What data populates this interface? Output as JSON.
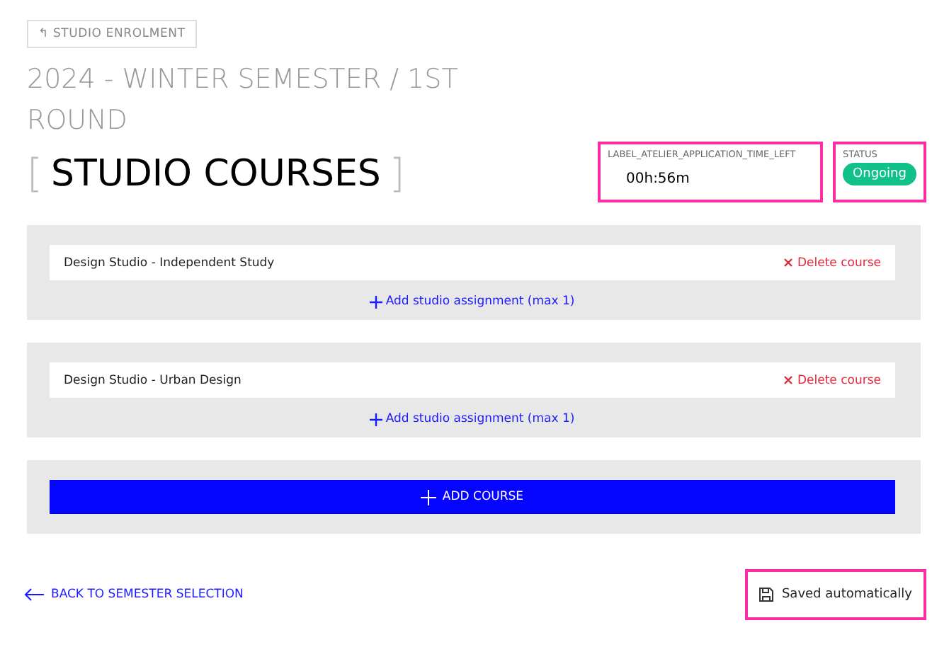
{
  "back_button": {
    "icon": "↰",
    "label": "STUDIO ENROLMENT"
  },
  "title": "2024 - WINTER SEMESTER / 1ST ROUND",
  "heading": {
    "open": "[",
    "text": "STUDIO COURSES",
    "close": "]"
  },
  "timer": {
    "label": "LABEL_ATELIER_APPLICATION_TIME_LEFT",
    "value": "00h:56m"
  },
  "status": {
    "label": "STATUS",
    "value": "Ongoing"
  },
  "courses": [
    {
      "name": "Design Studio - Independent Study",
      "delete": "Delete course",
      "add": "Add studio assignment (max 1)"
    },
    {
      "name": "Design Studio - Urban Design",
      "delete": "Delete course",
      "add": "Add studio assignment (max 1)"
    }
  ],
  "add_course": "ADD COURSE",
  "back_link": "BACK TO SEMESTER SELECTION",
  "save_status": "Saved automatically"
}
